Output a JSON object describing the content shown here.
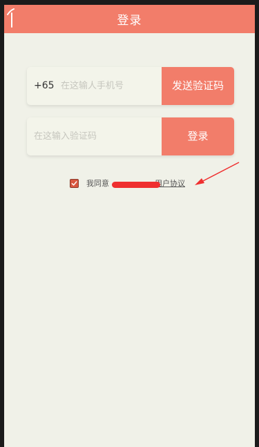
{
  "header": {
    "title": "登录"
  },
  "phone_row": {
    "country_code": "+65",
    "placeholder": "在这输人手机号",
    "send_code_button": "发送验证码"
  },
  "code_row": {
    "placeholder": "在这输入验证码",
    "login_button": "登录"
  },
  "agreement": {
    "checked": true,
    "prefix": "我同意",
    "link_text": "用户协议"
  },
  "colors": {
    "accent": "#f27d6a",
    "background": "#f0f1e8",
    "annotation_red": "#ef2f2f"
  }
}
